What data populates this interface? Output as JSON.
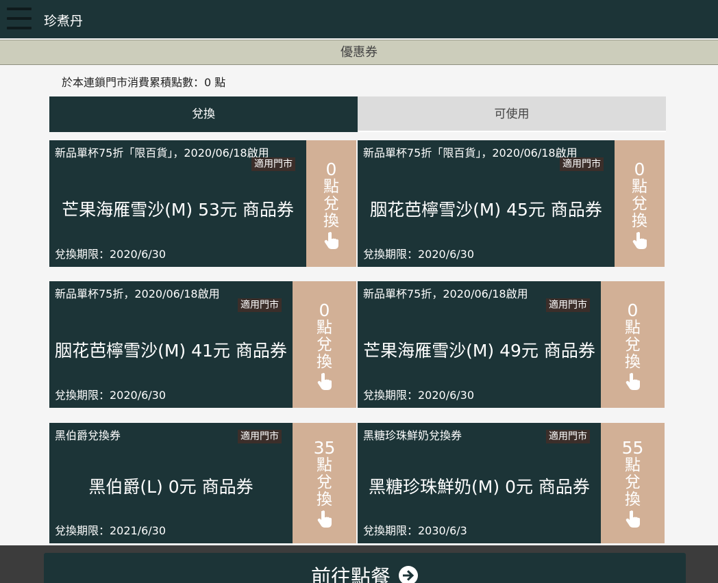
{
  "header": {
    "title": "珍煮丹",
    "menu_icon": "hamburger-menu-icon"
  },
  "section": {
    "title": "優惠券"
  },
  "points_summary": "於本連鎖門市消費累積點數：0 點",
  "tabs": [
    {
      "label": "兌換",
      "active": true
    },
    {
      "label": "可使用",
      "active": false
    }
  ],
  "coupons": [
    {
      "promo": "新品單杯75折「限百貨」，2020/06/18啟用",
      "store_badge": "適用門市",
      "product": "芒果海雁雪沙(M) 53元 商品券",
      "expiry": "兌換期限：2020/6/30",
      "points": "0",
      "redeem_chars": [
        "點",
        "兌",
        "換"
      ]
    },
    {
      "promo": "新品單杯75折「限百貨」，2020/06/18啟用",
      "store_badge": "適用門市",
      "product": "胭花芭檸雪沙(M) 45元 商品券",
      "expiry": "兌換期限：2020/6/30",
      "points": "0",
      "redeem_chars": [
        "點",
        "兌",
        "換"
      ]
    },
    {
      "promo": "新品單杯75折，2020/06/18啟用",
      "store_badge": "適用門市",
      "product": "胭花芭檸雪沙(M) 41元 商品券",
      "expiry": "兌換期限：2020/6/30",
      "points": "0",
      "redeem_chars": [
        "點",
        "兌",
        "換"
      ]
    },
    {
      "promo": "新品單杯75折，2020/06/18啟用",
      "store_badge": "適用門市",
      "product": "芒果海雁雪沙(M) 49元 商品券",
      "expiry": "兌換期限：2020/6/30",
      "points": "0",
      "redeem_chars": [
        "點",
        "兌",
        "換"
      ]
    },
    {
      "promo": "黑伯爵兌換券",
      "store_badge": "適用門市",
      "product": "黑伯爵(L) 0元 商品券",
      "expiry": "兌換期限：2021/6/30",
      "points": "35",
      "redeem_chars": [
        "點",
        "兌",
        "換"
      ]
    },
    {
      "promo": "黑糖珍珠鮮奶兌換券",
      "store_badge": "適用門市",
      "product": "黑糖珍珠鮮奶(M) 0元 商品券",
      "expiry": "兌換期限：2030/6/3",
      "points": "55",
      "redeem_chars": [
        "點",
        "兌",
        "換"
      ]
    }
  ],
  "footer_button": {
    "label": "前往點餐",
    "icon": "arrow-right-circle-icon"
  },
  "colors": {
    "header": "#1c3437",
    "card": "#1c3437",
    "redeem": "#d2b096",
    "subbar": "#cccdbb",
    "tab_inactive": "#dcdcdc"
  }
}
